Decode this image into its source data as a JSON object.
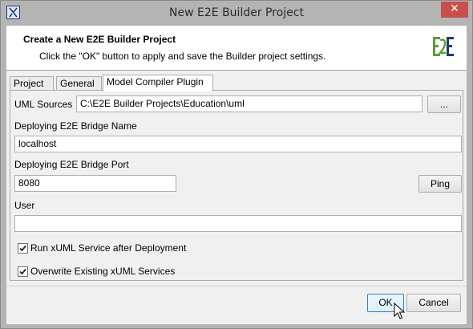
{
  "window": {
    "title": "New E2E Builder Project",
    "close_glyph": "✕"
  },
  "header": {
    "title": "Create a New E2E Builder Project",
    "description": "Click the \"OK\" button to apply and save the Builder project settings.",
    "logo_text": "E2E"
  },
  "tabs": [
    {
      "label": "Project",
      "active": false
    },
    {
      "label": "General",
      "active": false
    },
    {
      "label": "Model Compiler Plugin",
      "active": true
    }
  ],
  "form": {
    "uml_sources_label": "UML Sources",
    "uml_sources_value": "C:\\E2E Builder Projects\\Education\\uml",
    "browse_label": "...",
    "bridge_name_label": "Deploying E2E Bridge Name",
    "bridge_name_value": "localhost",
    "bridge_port_label": "Deploying E2E Bridge Port",
    "bridge_port_value": "8080",
    "ping_label": "Ping",
    "user_label": "User",
    "user_value": "",
    "run_service_label": "Run xUML Service after Deployment",
    "run_service_checked": true,
    "overwrite_label": "Overwrite Existing xUML Services",
    "overwrite_checked": true
  },
  "footer": {
    "ok_label": "OK",
    "cancel_label": "Cancel"
  },
  "colors": {
    "logo_green": "#5a9e3a",
    "logo_navy": "#1f3b66",
    "close_red": "#c7504c"
  }
}
